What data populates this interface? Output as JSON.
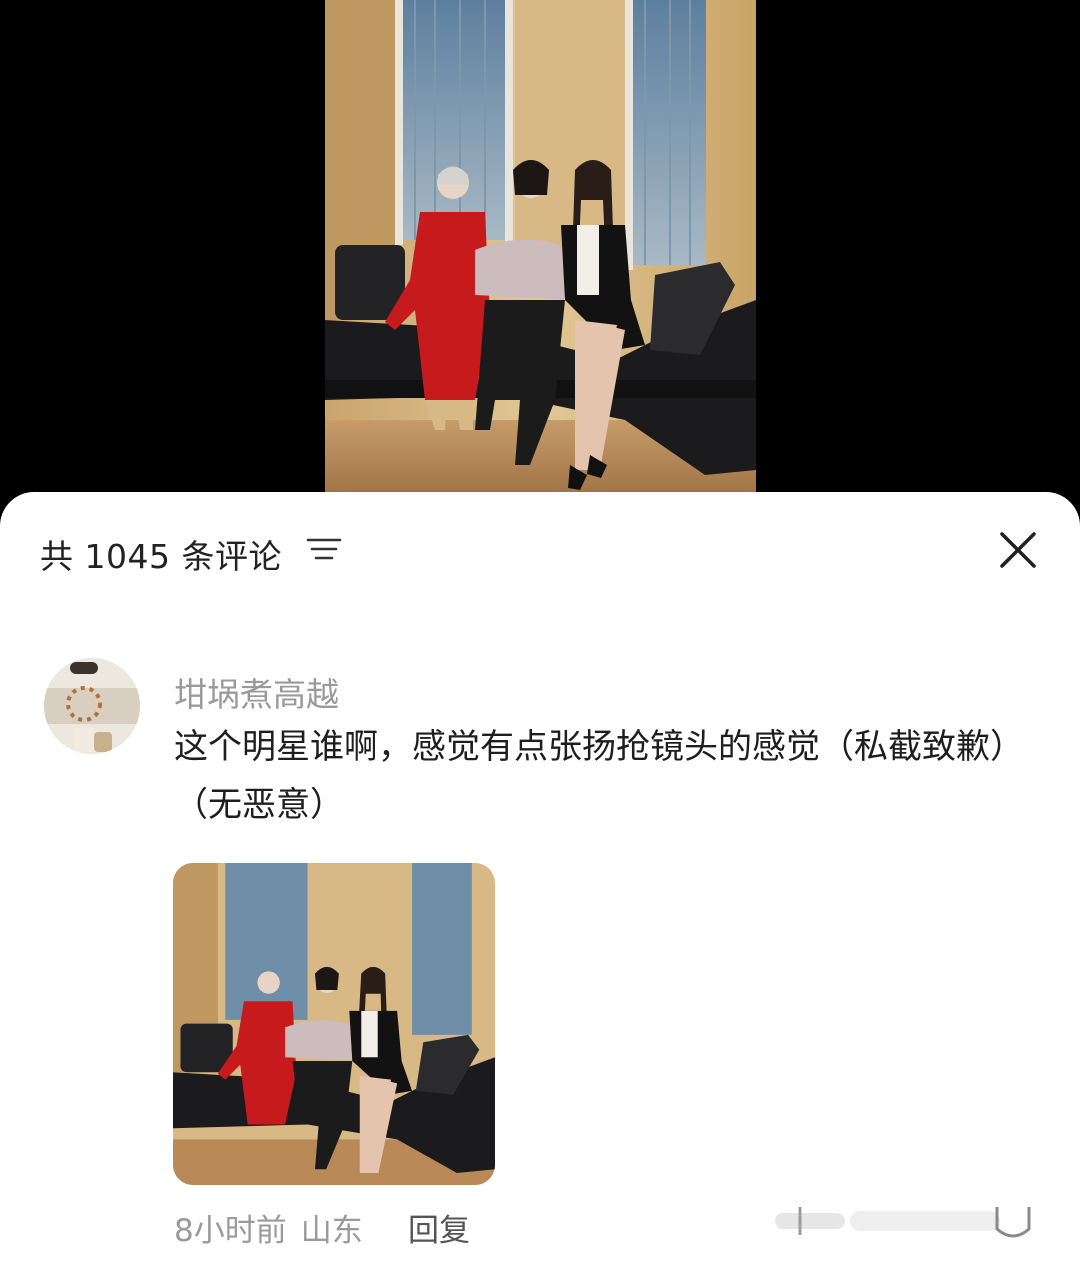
{
  "header": {
    "comment_count_label": "共 1045 条评论",
    "sort_icon": "sort-lines-icon",
    "close_icon": "close-icon"
  },
  "comment": {
    "username": "坩埚煮高越",
    "text": "这个明星谁啊，感觉有点张扬抢镜头的感觉（私截致歉）（无恶意）",
    "time": "8小时前",
    "location": "山东",
    "reply_label": "回复"
  },
  "colors": {
    "sheet_bg": "#ffffff",
    "backdrop": "#000000",
    "muted_text": "#9a9a9a",
    "primary_text": "#1e1e1e"
  }
}
